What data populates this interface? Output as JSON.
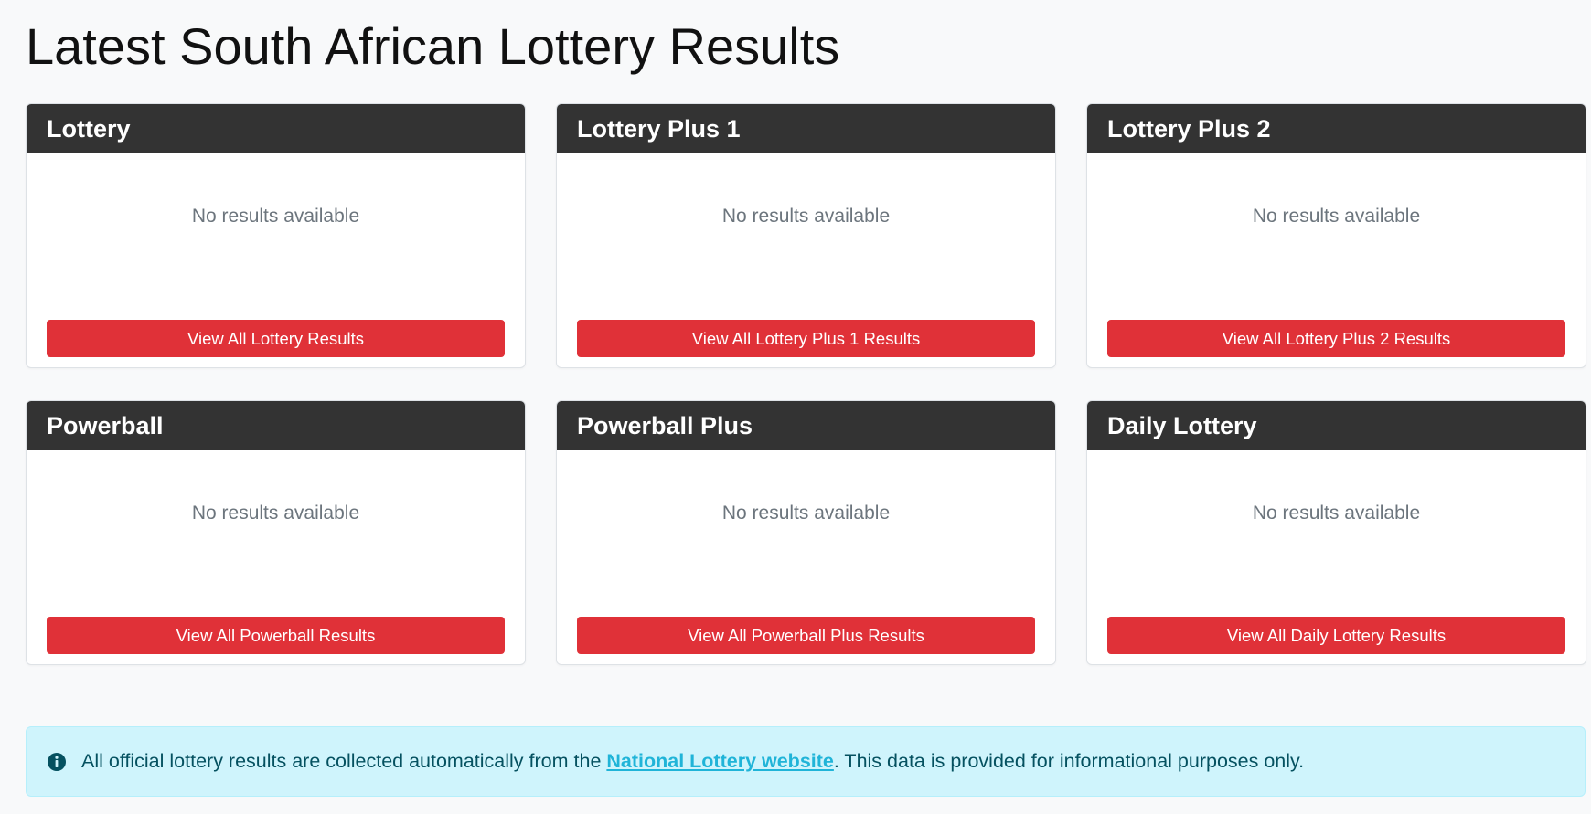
{
  "page": {
    "title": "Latest South African Lottery Results"
  },
  "cards": [
    {
      "title": "Lottery",
      "message": "No results available",
      "button": "View All Lottery Results"
    },
    {
      "title": "Lottery Plus 1",
      "message": "No results available",
      "button": "View All Lottery Plus 1 Results"
    },
    {
      "title": "Lottery Plus 2",
      "message": "No results available",
      "button": "View All Lottery Plus 2 Results"
    },
    {
      "title": "Powerball",
      "message": "No results available",
      "button": "View All Powerball Results"
    },
    {
      "title": "Powerball Plus",
      "message": "No results available",
      "button": "View All Powerball Plus Results"
    },
    {
      "title": "Daily Lottery",
      "message": "No results available",
      "button": "View All Daily Lottery Results"
    }
  ],
  "info": {
    "icon": "info-circle-icon",
    "text_before": "All official lottery results are collected automatically from the ",
    "link_text": "National Lottery website",
    "text_after": ". This data is provided for informational purposes only."
  },
  "colors": {
    "header_bg": "#333333",
    "button_bg": "#e03138",
    "alert_bg": "#cff4fc",
    "alert_text": "#055160",
    "link": "#20b4d8"
  }
}
